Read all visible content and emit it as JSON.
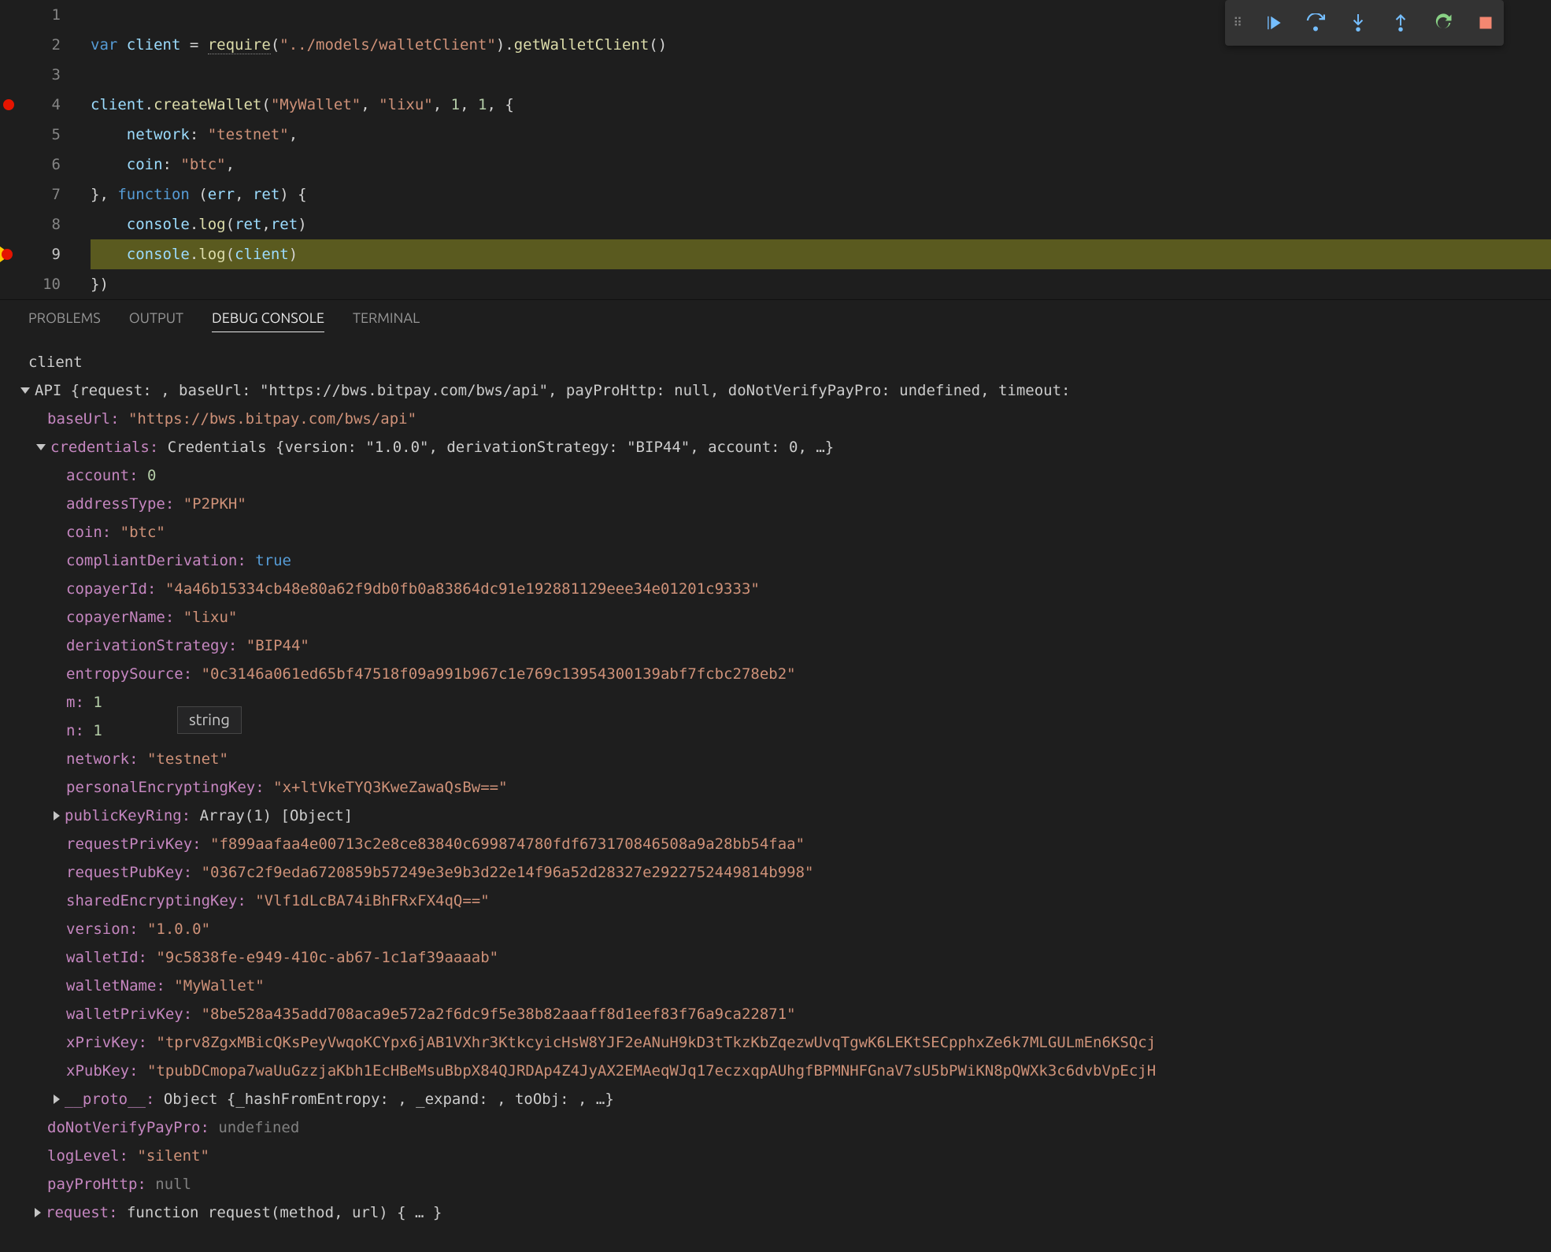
{
  "debugToolbar": {
    "continue": "Continue",
    "stepOver": "Step Over",
    "stepInto": "Step Into",
    "stepOut": "Step Out",
    "restart": "Restart",
    "stop": "Stop"
  },
  "editor": {
    "lineNumbers": [
      "1",
      "2",
      "3",
      "4",
      "5",
      "6",
      "7",
      "8",
      "9",
      "10"
    ],
    "activeLine": 9,
    "breakpoints": {
      "red": [
        4
      ],
      "current": [
        9
      ]
    },
    "codeLines": {
      "l1": "",
      "l2": {
        "kw": "var",
        "name": " client ",
        "eq": "= ",
        "req": "require",
        "lp": "(",
        "path": "\"../models/walletClient\"",
        "rp": ").",
        "get": "getWalletClient",
        "paren": "()"
      },
      "l3": "",
      "l4": {
        "obj": "client",
        "dot": ".",
        "fn": "createWallet",
        "lp": "(",
        "a1": "\"MyWallet\"",
        "c": ", ",
        "a2": "\"lixu\"",
        "a3": "1",
        "a4": "1",
        "brace": ", {"
      },
      "l5": {
        "prop": "network",
        "colon": ": ",
        "val": "\"testnet\"",
        "comma": ","
      },
      "l6": {
        "prop": "coin",
        "colon": ": ",
        "val": "\"btc\"",
        "comma": ","
      },
      "l7": {
        "close": "}, ",
        "kw": "function",
        "sp": " (",
        "p1": "err",
        "c": ", ",
        "p2": "ret",
        "rp": ") {"
      },
      "l8": {
        "obj": "console",
        "dot": ".",
        "fn": "log",
        "lp": "(",
        "a1": "ret",
        "c": ",",
        "a2": "ret",
        "rp": ")"
      },
      "l9": {
        "obj": "console",
        "dot": ".",
        "fn": "log",
        "lp": "(",
        "a1": "client",
        "rp": ")"
      },
      "l10": "})"
    }
  },
  "panel": {
    "tabs": {
      "problems": "PROBLEMS",
      "output": "OUTPUT",
      "debugConsole": "DEBUG CONSOLE",
      "terminal": "TERMINAL"
    },
    "active": "debugConsole"
  },
  "hoverTip": "string",
  "console": {
    "l01": "client",
    "l02": {
      "prefix": "API {",
      "body": "request: , baseUrl: \"https://bws.bitpay.com/bws/api\", payProHttp: null, doNotVerifyPayPro: undefined, timeout:"
    },
    "l03": {
      "k": "baseUrl:",
      "v": "\"https://bws.bitpay.com/bws/api\""
    },
    "l04": {
      "k": "credentials:",
      "body": "Credentials {version: \"1.0.0\", derivationStrategy: \"BIP44\", account: 0, …}"
    },
    "l05": {
      "k": "account:",
      "v": "0"
    },
    "l06": {
      "k": "addressType:",
      "v": "\"P2PKH\""
    },
    "l07": {
      "k": "coin:",
      "v": "\"btc\""
    },
    "l08": {
      "k": "compliantDerivation:",
      "v": "true"
    },
    "l09": {
      "k": "copayerId:",
      "v": "\"4a46b15334cb48e80a62f9db0fb0a83864dc91e192881129eee34e01201c9333\""
    },
    "l10": {
      "k": "copayerName:",
      "v": "\"lixu\""
    },
    "l11": {
      "k": "derivationStrategy:",
      "v": "\"BIP44\""
    },
    "l12": {
      "k": "entropySource:",
      "v": "\"0c3146a061ed65bf47518f09a991b967c1e769c13954300139abf7fcbc278eb2\""
    },
    "l13": {
      "k": "m:",
      "v": "1"
    },
    "l14": {
      "k": "n:",
      "v": "1"
    },
    "l15": {
      "k": "network:",
      "v": "\"testnet\""
    },
    "l16": {
      "k": "personalEncryptingKey:",
      "v": "\"x+ltVkeTYQ3KweZawaQsBw==\""
    },
    "l17": {
      "k": "publicKeyRing:",
      "body": "Array(1) [Object]"
    },
    "l18": {
      "k": "requestPrivKey:",
      "v": "\"f899aafaa4e00713c2e8ce83840c699874780fdf673170846508a9a28bb54faa\""
    },
    "l19": {
      "k": "requestPubKey:",
      "v": "\"0367c2f9eda6720859b57249e3e9b3d22e14f96a52d28327e2922752449814b998\""
    },
    "l20": {
      "k": "sharedEncryptingKey:",
      "v": "\"Vlf1dLcBA74iBhFRxFX4qQ==\""
    },
    "l21": {
      "k": "version:",
      "v": "\"1.0.0\""
    },
    "l22": {
      "k": "walletId:",
      "v": "\"9c5838fe-e949-410c-ab67-1c1af39aaaab\""
    },
    "l23": {
      "k": "walletName:",
      "v": "\"MyWallet\""
    },
    "l24": {
      "k": "walletPrivKey:",
      "v": "\"8be528a435add708aca9e572a2f6dc9f5e38b82aaaff8d1eef83f76a9ca22871\""
    },
    "l25": {
      "k": "xPrivKey:",
      "v": "\"tprv8ZgxMBicQKsPeyVwqoKCYpx6jAB1VXhr3KtkcyicHsW8YJF2eANuH9kD3tTkzKbZqezwUvqTgwK6LEKtSECpphxZe6k7MLGULmEn6KSQcj"
    },
    "l26": {
      "k": "xPubKey:",
      "v": "\"tpubDCmopa7waUuGzzjaKbh1EcHBeMsuBbpX84QJRDAp4Z4JyAX2EMAeqWJq17eczxqpAUhgfBPMNHFGnaV7sU5bPWiKN8pQWXk3c6dvbVpEcjH"
    },
    "l27": {
      "k": "__proto__:",
      "body": "Object {_hashFromEntropy: , _expand: , toObj: , …}"
    },
    "l28": {
      "k": "doNotVerifyPayPro:",
      "v": "undefined"
    },
    "l29": {
      "k": "logLevel:",
      "v": "\"silent\""
    },
    "l30": {
      "k": "payProHttp:",
      "v": "null"
    },
    "l31": {
      "k": "request:",
      "body": "function request(method, url) { … }"
    }
  }
}
